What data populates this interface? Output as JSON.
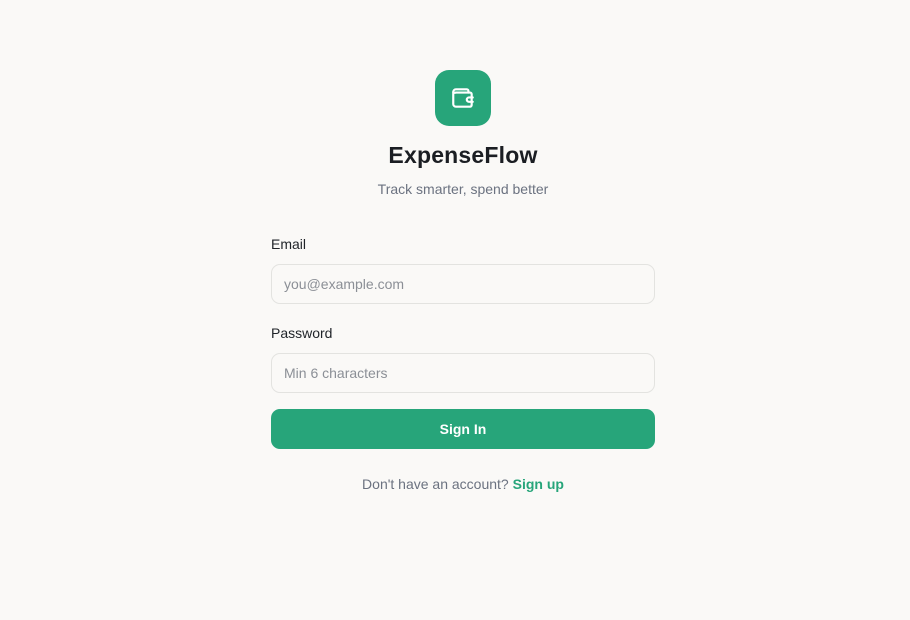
{
  "brand": {
    "name": "ExpenseFlow",
    "tagline": "Track smarter, spend better",
    "icon": "wallet-icon",
    "accent_color": "#27a57a"
  },
  "form": {
    "email_label": "Email",
    "email_placeholder": "you@example.com",
    "email_value": "",
    "password_label": "Password",
    "password_placeholder": "Min 6 characters",
    "password_value": "",
    "submit_label": "Sign In"
  },
  "footer": {
    "prompt": "Don't have an account?",
    "link_label": "Sign up"
  }
}
